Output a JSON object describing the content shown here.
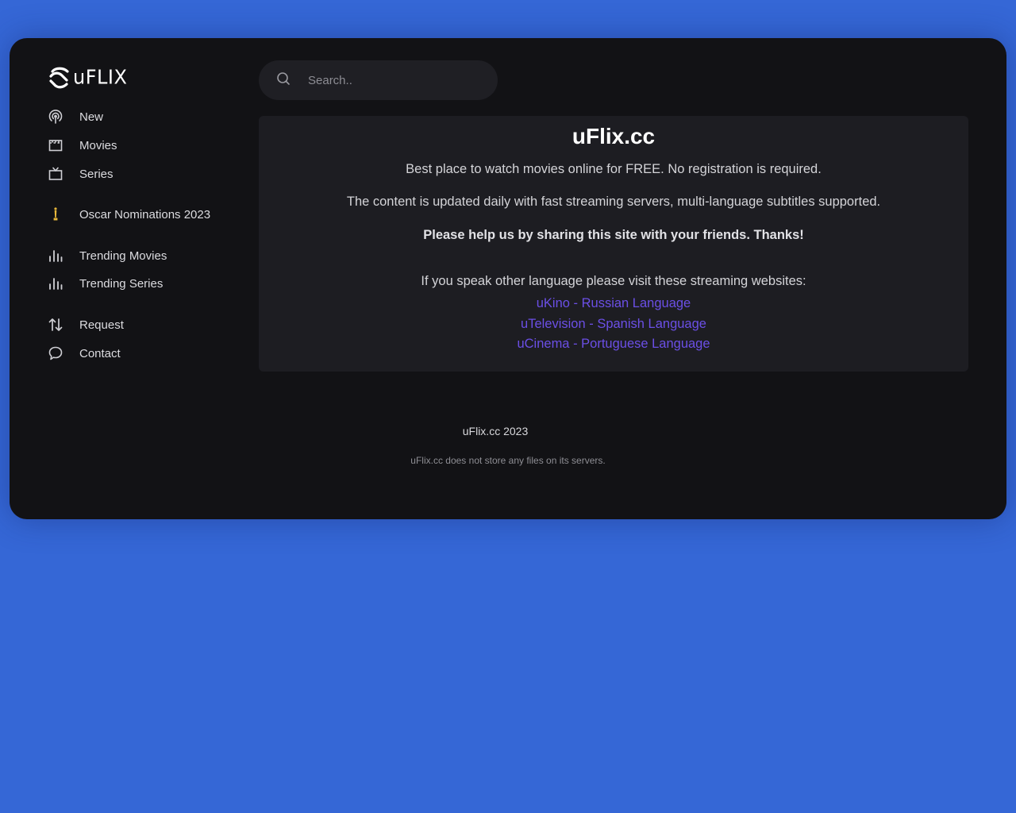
{
  "brand": {
    "logo_text": "uFLIX"
  },
  "sidebar": {
    "items": [
      {
        "label": "New",
        "icon": "podcast-icon"
      },
      {
        "label": "Movies",
        "icon": "clapperboard-icon"
      },
      {
        "label": "Series",
        "icon": "tv-icon"
      },
      {
        "label": "Oscar Nominations 2023",
        "icon": "oscar-icon"
      },
      {
        "label": "Trending Movies",
        "icon": "bar-chart-icon"
      },
      {
        "label": "Trending Series",
        "icon": "bar-chart-icon"
      },
      {
        "label": "Request",
        "icon": "arrows-up-down-icon"
      },
      {
        "label": "Contact",
        "icon": "chat-bubble-icon"
      }
    ]
  },
  "search": {
    "placeholder": "Search.."
  },
  "info": {
    "title": "uFlix.cc",
    "line1": "Best place to watch movies online for FREE. No registration is required.",
    "line2": "The content is updated daily with fast streaming servers, multi-language subtitles supported.",
    "line3": "Please help us by sharing this site with your friends. Thanks!",
    "line4": "If you speak other language please visit these streaming websites:",
    "links": [
      "uKino - Russian Language",
      "uTelevision - Spanish Language",
      "uCinema - Portuguese Language"
    ]
  },
  "footer": {
    "copyright": "uFlix.cc 2023",
    "disclaimer": "uFlix.cc does not store any files on its servers."
  },
  "colors": {
    "page_bg": "#3567d6",
    "app_bg": "#121215",
    "card_bg": "#1d1d22",
    "link": "#6b4fe6",
    "oscar": "#e8b83a"
  }
}
